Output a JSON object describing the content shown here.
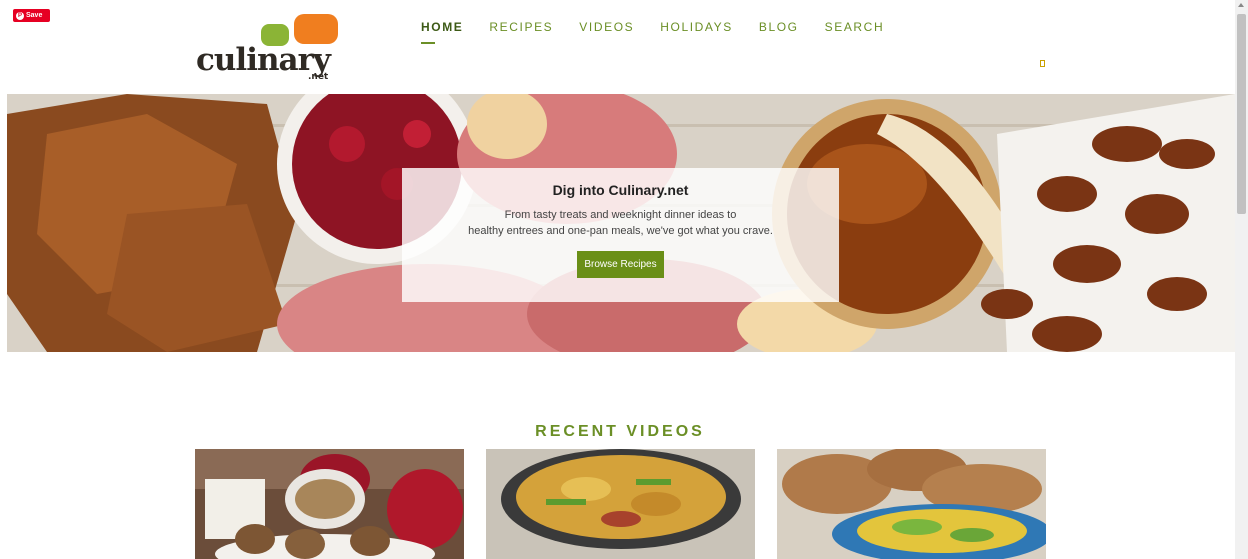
{
  "pinterest": {
    "save_label": "Save",
    "icon": "pinterest-icon"
  },
  "logo": {
    "text": "culinary",
    "suffix": ".net"
  },
  "nav": [
    {
      "label": "HOME",
      "active": true
    },
    {
      "label": "RECIPES",
      "active": false
    },
    {
      "label": "VIDEOS",
      "active": false
    },
    {
      "label": "HOLIDAYS",
      "active": false
    },
    {
      "label": "BLOG",
      "active": false
    },
    {
      "label": "SEARCH",
      "active": false
    }
  ],
  "hero": {
    "title": "Dig into Culinary.net",
    "subtitle_line1": "From tasty treats and weeknight dinner ideas to",
    "subtitle_line2": "healthy entrees and one-pan meals, we've got what you crave.",
    "button_label": "Browse Recipes"
  },
  "recent_videos": {
    "title": "RECENT VIDEOS"
  },
  "colors": {
    "accent": "#6b8f26",
    "button": "#6a8f17",
    "pinterest": "#e60023"
  }
}
